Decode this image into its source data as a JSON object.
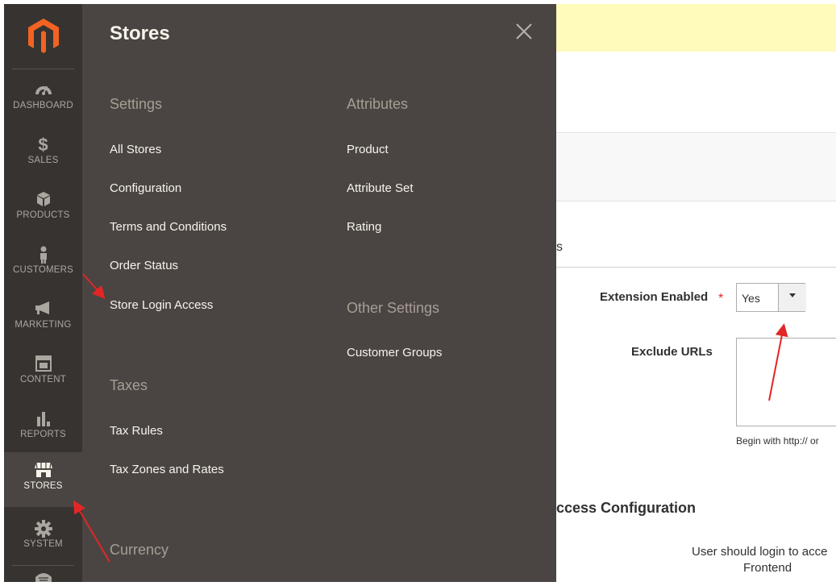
{
  "sidebar": {
    "items": [
      {
        "label": "DASHBOARD",
        "icon": "dashboard-icon"
      },
      {
        "label": "SALES",
        "icon": "dollar-icon"
      },
      {
        "label": "PRODUCTS",
        "icon": "box-icon"
      },
      {
        "label": "CUSTOMERS",
        "icon": "person-icon"
      },
      {
        "label": "MARKETING",
        "icon": "megaphone-icon"
      },
      {
        "label": "CONTENT",
        "icon": "layout-icon"
      },
      {
        "label": "REPORTS",
        "icon": "bar-chart-icon"
      },
      {
        "label": "STORES",
        "icon": "storefront-icon",
        "active": true
      },
      {
        "label": "SYSTEM",
        "icon": "gear-icon"
      }
    ]
  },
  "flyout": {
    "title": "Stores",
    "settings": {
      "title": "Settings",
      "links": [
        "All Stores",
        "Configuration",
        "Terms and Conditions",
        "Order Status",
        "Store Login Access"
      ]
    },
    "taxes": {
      "title": "Taxes",
      "links": [
        "Tax Rules",
        "Tax Zones and Rates"
      ]
    },
    "currency": {
      "title": "Currency"
    },
    "attributes": {
      "title": "Attributes",
      "links": [
        "Product",
        "Attribute Set",
        "Rating"
      ]
    },
    "other_settings": {
      "title": "Other Settings",
      "links": [
        "Customer Groups"
      ]
    }
  },
  "config": {
    "section_fragment": "s",
    "extension_enabled": {
      "label": "Extension Enabled",
      "required_mark": "*",
      "value": "Yes"
    },
    "exclude_urls": {
      "label": "Exclude URLs",
      "hint": "Begin with http:// or"
    },
    "access_configuration_title": "ccess Configuration",
    "user_login_label": "User should login to acce",
    "frontend_label": "Frontend"
  },
  "colors": {
    "sidebar_bg": "#373330",
    "flyout_bg": "#4a4542",
    "banner": "#fffbbb",
    "annotation_arrow": "#e22626"
  }
}
